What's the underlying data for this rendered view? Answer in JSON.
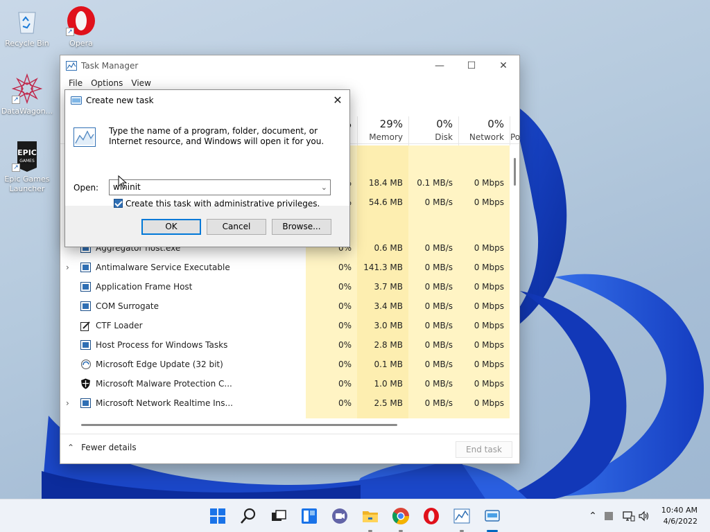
{
  "desktop": {
    "icons": [
      {
        "label": "Recycle Bin",
        "icon": "recycle-bin-icon"
      },
      {
        "label": "Opera",
        "icon": "opera-icon"
      },
      {
        "label": "DataWagon...",
        "icon": "datawagon-icon"
      },
      {
        "label": "Epic Games Launcher",
        "icon": "epic-games-icon"
      }
    ]
  },
  "task_manager": {
    "title": "Task Manager",
    "menu": [
      "File",
      "Options",
      "View"
    ],
    "columns": [
      {
        "pct": "29%",
        "label": "Memory"
      },
      {
        "pct": "0%",
        "label": "Disk"
      },
      {
        "pct": "0%",
        "label": "Network"
      },
      {
        "pct": "",
        "label": "Po"
      }
    ],
    "partial_rows": [
      {
        "cpu": "%",
        "mem": "18.4 MB",
        "disk": "0.1 MB/s",
        "net": "0 Mbps"
      },
      {
        "cpu": "%",
        "mem": "54.6 MB",
        "disk": "0 MB/s",
        "net": "0 Mbps"
      }
    ],
    "rows": [
      {
        "name": "Aggregator host.exe",
        "expand": false,
        "cpu": "0%",
        "mem": "0.6 MB",
        "disk": "0 MB/s",
        "net": "0 Mbps"
      },
      {
        "name": "Antimalware Service Executable",
        "expand": true,
        "cpu": "0%",
        "mem": "141.3 MB",
        "disk": "0 MB/s",
        "net": "0 Mbps"
      },
      {
        "name": "Application Frame Host",
        "expand": false,
        "cpu": "0%",
        "mem": "3.7 MB",
        "disk": "0 MB/s",
        "net": "0 Mbps"
      },
      {
        "name": "COM Surrogate",
        "expand": false,
        "cpu": "0%",
        "mem": "3.4 MB",
        "disk": "0 MB/s",
        "net": "0 Mbps"
      },
      {
        "name": "CTF Loader",
        "expand": false,
        "cpu": "0%",
        "mem": "3.0 MB",
        "disk": "0 MB/s",
        "net": "0 Mbps"
      },
      {
        "name": "Host Process for Windows Tasks",
        "expand": false,
        "cpu": "0%",
        "mem": "2.8 MB",
        "disk": "0 MB/s",
        "net": "0 Mbps"
      },
      {
        "name": "Microsoft Edge Update (32 bit)",
        "expand": false,
        "cpu": "0%",
        "mem": "0.1 MB",
        "disk": "0 MB/s",
        "net": "0 Mbps"
      },
      {
        "name": "Microsoft Malware Protection C...",
        "expand": false,
        "cpu": "0%",
        "mem": "1.0 MB",
        "disk": "0 MB/s",
        "net": "0 Mbps"
      },
      {
        "name": "Microsoft Network Realtime Ins...",
        "expand": true,
        "cpu": "0%",
        "mem": "2.5 MB",
        "disk": "0 MB/s",
        "net": "0 Mbps"
      }
    ],
    "fewer_details": "Fewer details",
    "end_task": "End task"
  },
  "dialog": {
    "title": "Create new task",
    "message": "Type the name of a program, folder, document, or Internet resource, and Windows will open it for you.",
    "open_label": "Open:",
    "open_value": "wininit",
    "admin_label": "Create this task with administrative privileges.",
    "admin_checked": true,
    "ok": "OK",
    "cancel": "Cancel",
    "browse": "Browse..."
  },
  "taskbar": {
    "apps": [
      "start-icon",
      "search-icon",
      "task-view-icon",
      "widgets-icon",
      "chat-icon",
      "file-explorer-icon",
      "chrome-icon",
      "opera-icon",
      "task-manager-icon",
      "run-dialog-icon"
    ],
    "time": "10:40 AM",
    "date": "4/6/2022"
  },
  "colors": {
    "accent": "#0078d7",
    "heat_yellow": "#fff4c4",
    "heat_yellow_dark": "#fdeeb0"
  }
}
